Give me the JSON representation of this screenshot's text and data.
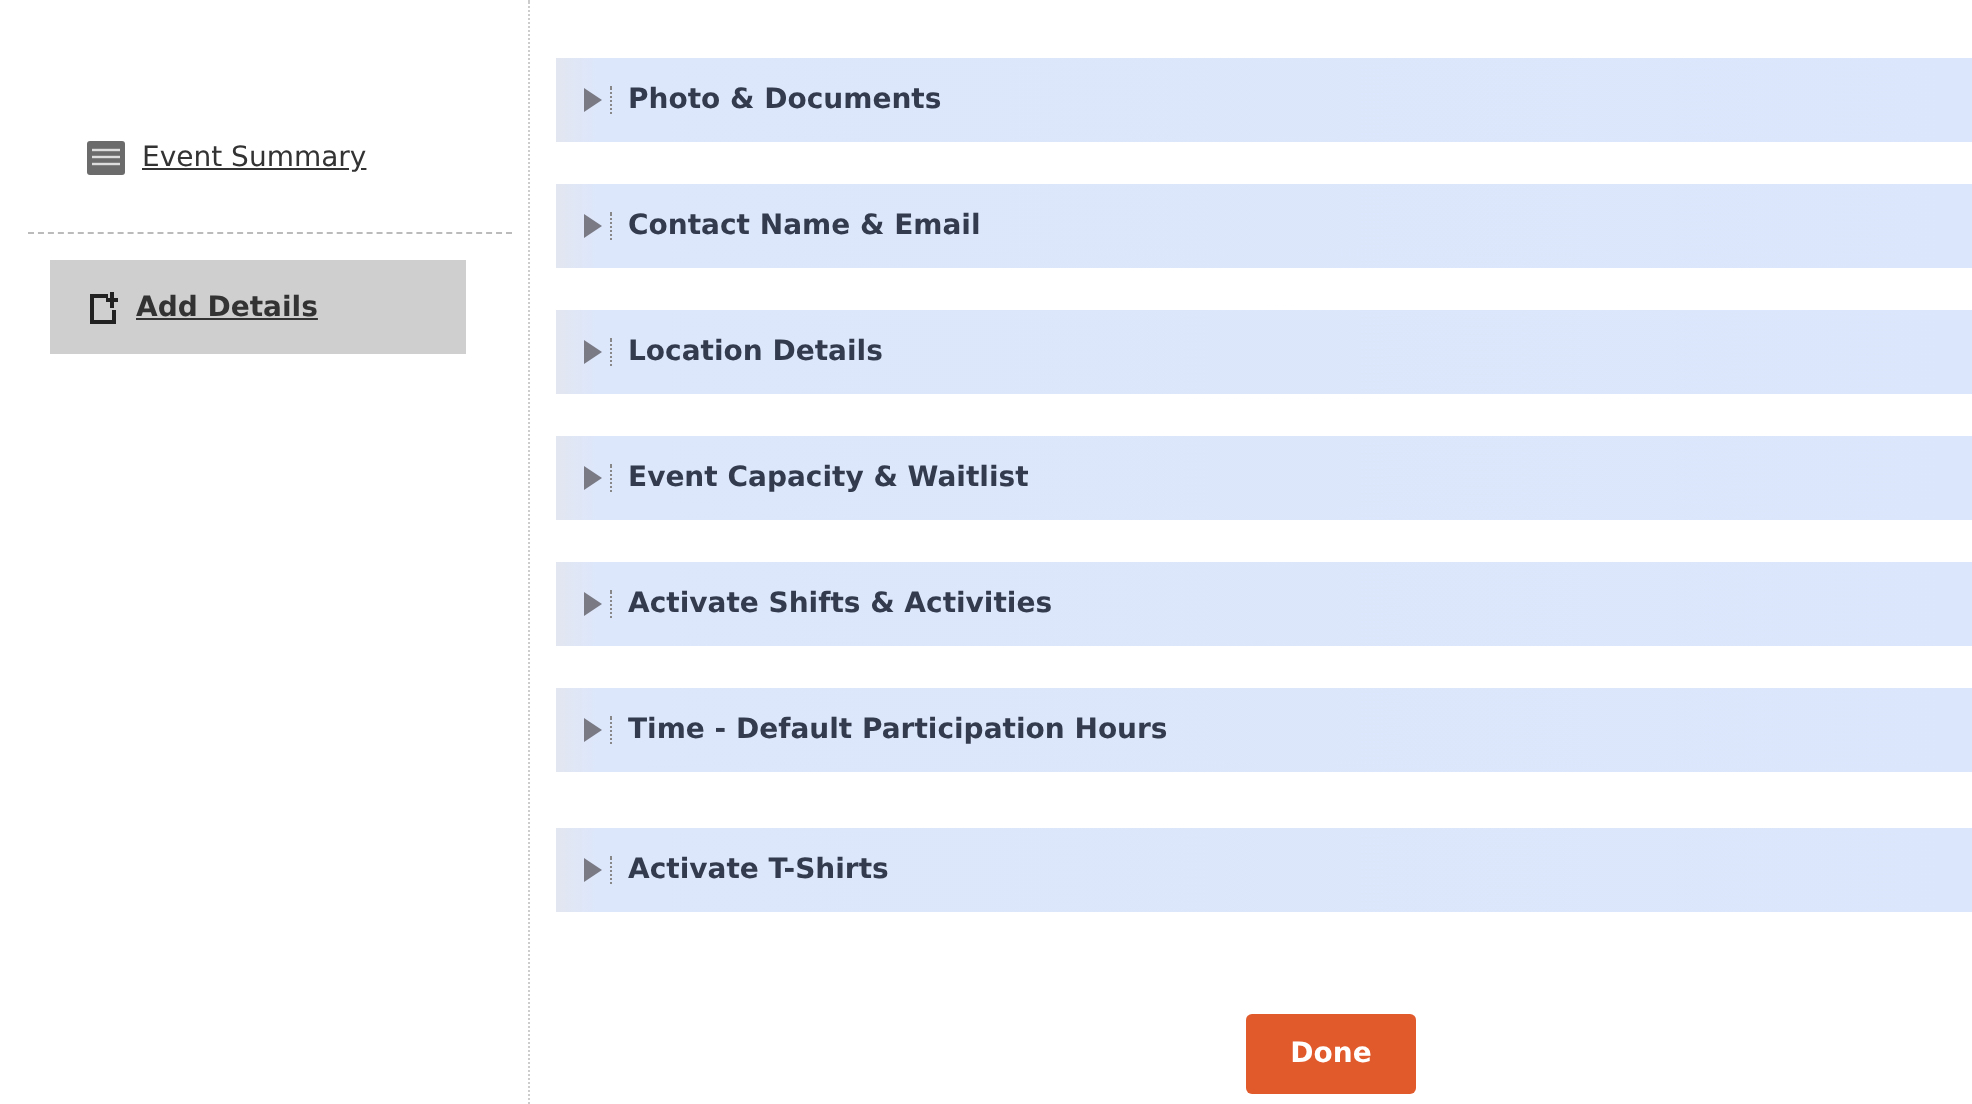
{
  "sidebar": {
    "items": [
      {
        "label": "Event Summary",
        "kind": "summary",
        "selected": false
      },
      {
        "label": "Add Details",
        "kind": "add",
        "selected": true
      }
    ]
  },
  "sections": [
    {
      "title": "Photo & Documents",
      "expanded": false
    },
    {
      "title": "Contact Name & Email",
      "expanded": false
    },
    {
      "title": "Location Details",
      "expanded": false
    },
    {
      "title": "Event Capacity & Waitlist",
      "expanded": false
    },
    {
      "title": "Activate Shifts & Activities",
      "expanded": false
    },
    {
      "title": "Time - Default Participation Hours",
      "expanded": false
    },
    {
      "title": "Activate T-Shirts",
      "expanded": false
    }
  ],
  "done_button": {
    "label": "Done"
  }
}
